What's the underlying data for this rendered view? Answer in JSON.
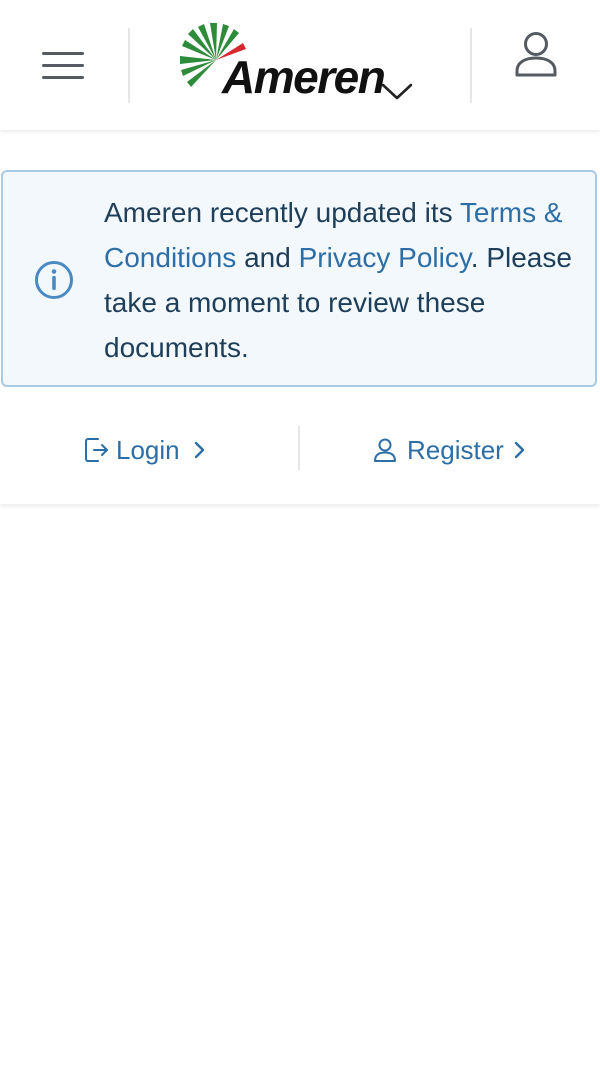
{
  "header": {
    "logo_text": "Ameren",
    "colors": {
      "logo_green": "#2e8b3a",
      "logo_red": "#d7282f",
      "icon_gray": "#555b61"
    },
    "icons": [
      "hamburger-menu-icon",
      "ameren-logo-icon",
      "chevron-down-icon",
      "user-account-icon"
    ]
  },
  "notice": {
    "text_1": "Ameren recently updated its ",
    "link_terms": "Terms & Conditions",
    "text_2": " and ",
    "link_privacy": "Privacy Policy",
    "text_3": ". Please take a moment to review these documents.",
    "icon": "info-icon",
    "colors": {
      "background": "#f3f8fd",
      "border": "#a9cbe6",
      "text": "#1f3e5a",
      "link": "#2e6ea6"
    }
  },
  "auth": {
    "login_label": "Login",
    "register_label": "Register",
    "icons": [
      "login-icon",
      "register-user-icon",
      "chevron-right-icon"
    ]
  }
}
